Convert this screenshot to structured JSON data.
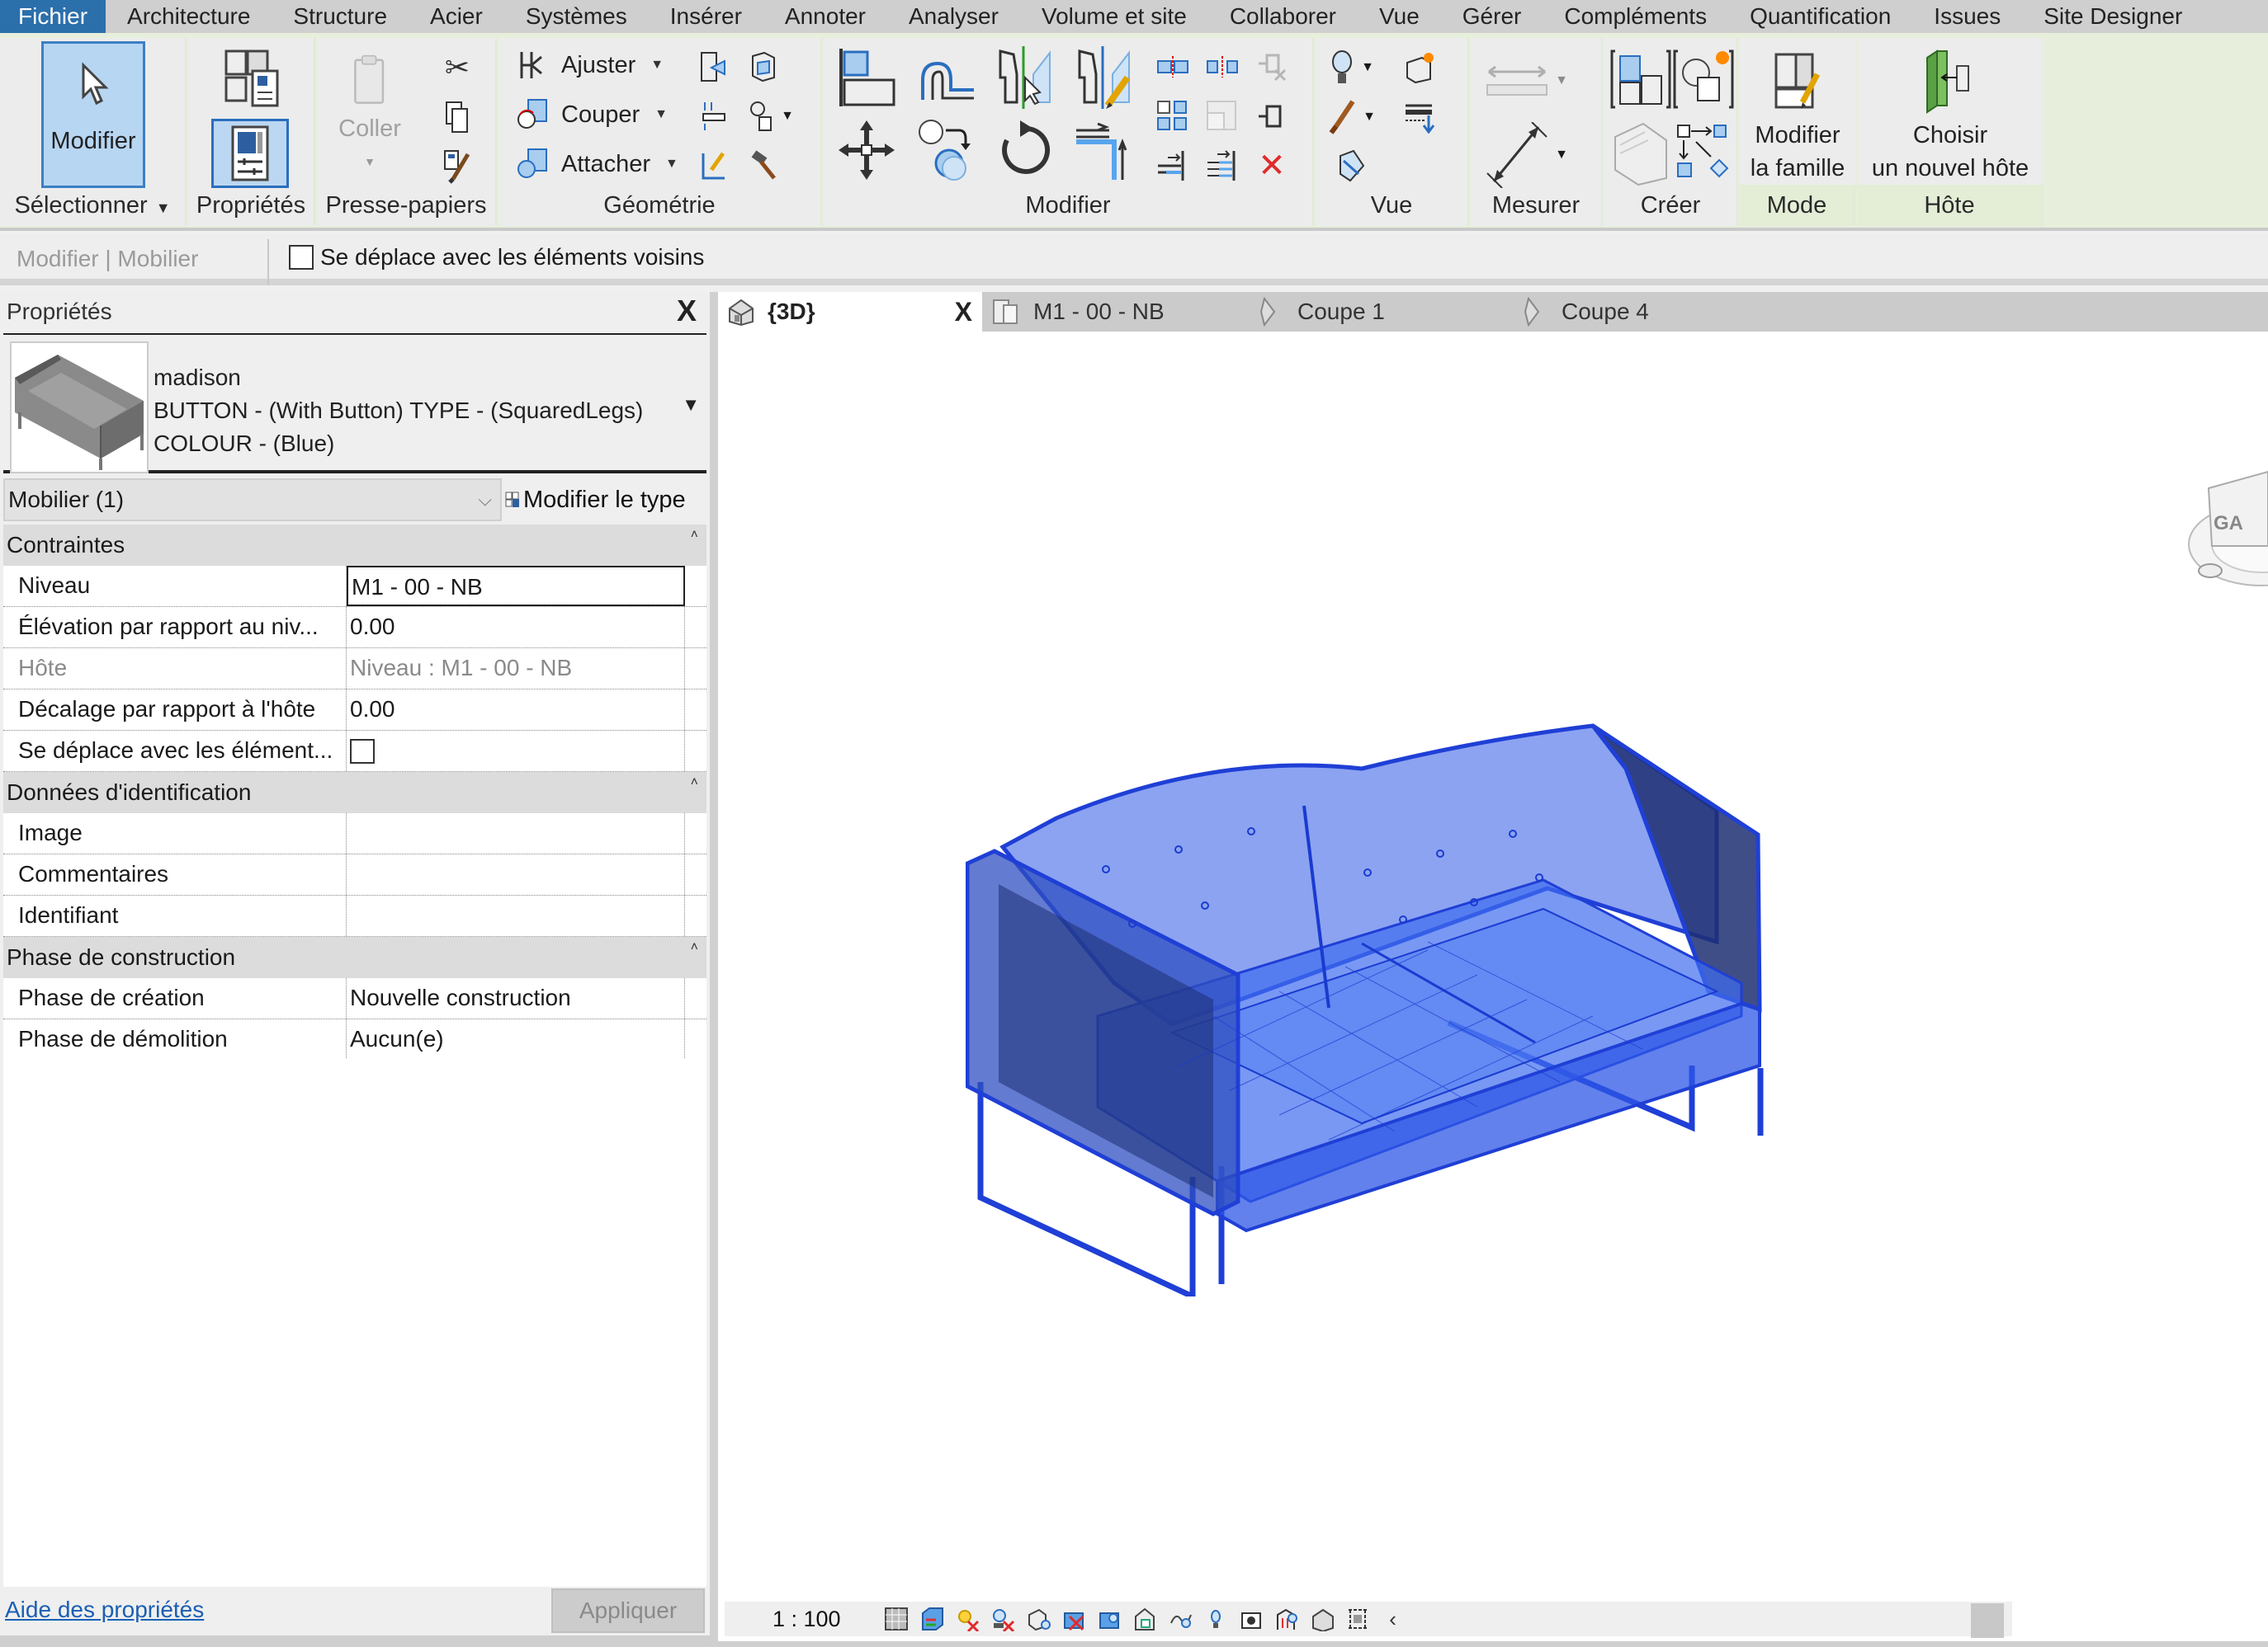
{
  "menubar": {
    "tabs": [
      {
        "label": "Fichier",
        "active": true
      },
      {
        "label": "Architecture"
      },
      {
        "label": "Structure"
      },
      {
        "label": "Acier"
      },
      {
        "label": "Systèmes"
      },
      {
        "label": "Insérer"
      },
      {
        "label": "Annoter"
      },
      {
        "label": "Analyser"
      },
      {
        "label": "Volume et site"
      },
      {
        "label": "Collaborer"
      },
      {
        "label": "Vue"
      },
      {
        "label": "Gérer"
      },
      {
        "label": "Compléments"
      },
      {
        "label": "Quantification"
      },
      {
        "label": "Issues"
      },
      {
        "label": "Site Designer"
      }
    ]
  },
  "ribbon": {
    "select_panel": {
      "title": "Sélectionner",
      "modify_label": "Modifier"
    },
    "properties_panel": {
      "title": "Propriétés"
    },
    "clipboard_panel": {
      "title": "Presse-papiers",
      "paste_label": "Coller"
    },
    "geometry_panel": {
      "title": "Géométrie",
      "trim_label": "Ajuster",
      "cut_label": "Couper",
      "attach_label": "Attacher"
    },
    "modify_panel": {
      "title": "Modifier"
    },
    "view_panel": {
      "title": "Vue"
    },
    "measure_panel": {
      "title": "Mesurer"
    },
    "create_panel": {
      "title": "Créer"
    },
    "mode_panel": {
      "title": "Mode",
      "edit_family_line1": "Modifier",
      "edit_family_line2": "la famille"
    },
    "host_panel": {
      "title": "Hôte",
      "pick_host_line1": "Choisir",
      "pick_host_line2": "un nouvel hôte"
    }
  },
  "options_bar": {
    "context": "Modifier | Mobilier",
    "moves_with_nearby_label": "Se déplace avec les éléments voisins",
    "moves_with_nearby_checked": false
  },
  "properties": {
    "title": "Propriétés",
    "type": {
      "family": "madison",
      "type_line1": "BUTTON - (With Button) TYPE - (SquaredLegs)",
      "type_line2": "COLOUR - (Blue)"
    },
    "category_filter": "Mobilier (1)",
    "edit_type_label": "Modifier le type",
    "groups": [
      {
        "name": "Contraintes",
        "rows": [
          {
            "name": "Niveau",
            "value": "M1 - 00 - NB",
            "editing": true
          },
          {
            "name": "Élévation par rapport au niv...",
            "value": "0.00"
          },
          {
            "name": "Hôte",
            "value": "Niveau : M1 - 00 - NB",
            "disabled": true
          },
          {
            "name": "Décalage par rapport à l'hôte",
            "value": "0.00"
          },
          {
            "name": "Se déplace avec les élément...",
            "value": "",
            "checkbox": true,
            "checked": false
          }
        ]
      },
      {
        "name": "Données d'identification",
        "rows": [
          {
            "name": "Image",
            "value": ""
          },
          {
            "name": "Commentaires",
            "value": ""
          },
          {
            "name": "Identifiant",
            "value": ""
          }
        ]
      },
      {
        "name": "Phase de construction",
        "rows": [
          {
            "name": "Phase de création",
            "value": "Nouvelle construction"
          },
          {
            "name": "Phase de démolition",
            "value": "Aucun(e)"
          }
        ]
      }
    ],
    "help_link": "Aide des propriétés",
    "apply_label": "Appliquer"
  },
  "view_tabs": [
    {
      "label": "{3D}",
      "icon": "3d-view-icon",
      "active": true,
      "closable": true
    },
    {
      "label": "M1 - 00 - NB",
      "icon": "floor-plan-icon"
    },
    {
      "label": "Coupe 1",
      "icon": "section-icon"
    },
    {
      "label": "Coupe 4",
      "icon": "section-icon"
    }
  ],
  "viewport": {
    "selected_element_color": "#1f3fd6",
    "viewcube_face_label": "GA"
  },
  "view_control_bar": {
    "scale": "1 : 100",
    "icons": [
      "detail-level-icon",
      "visual-style-icon",
      "sun-path-icon",
      "shadows-icon",
      "render-icon",
      "crop-view-icon",
      "show-crop-icon",
      "unlock-3d-icon",
      "temporary-hide-icon",
      "reveal-hidden-icon",
      "temporary-view-properties-icon",
      "analytical-model-icon",
      "highlight-displacement-icon",
      "constraints-icon",
      "collapse-icon"
    ]
  }
}
